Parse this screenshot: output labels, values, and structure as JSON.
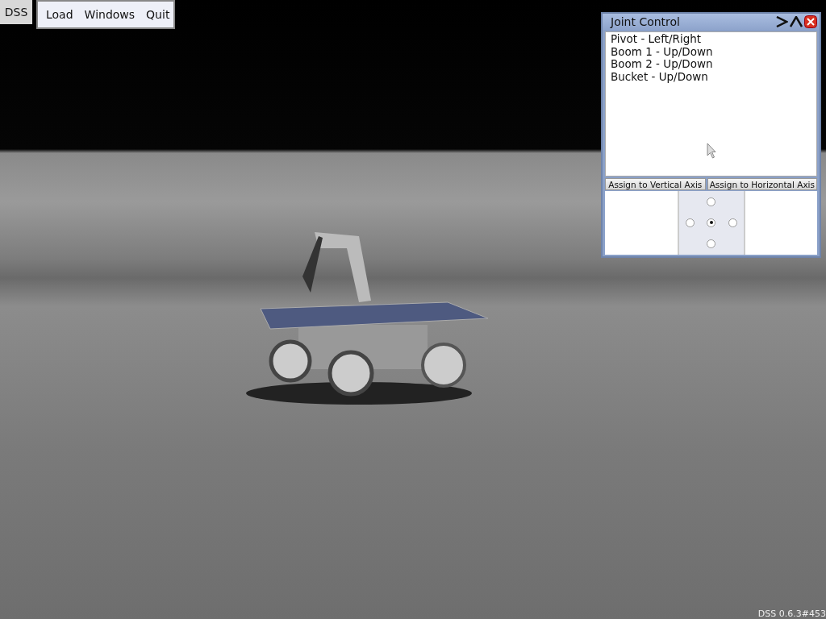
{
  "app_button": {
    "label": "DSS"
  },
  "menu": {
    "items": [
      {
        "label": "Load"
      },
      {
        "label": "Windows"
      },
      {
        "label": "Quit"
      }
    ]
  },
  "joint_control": {
    "title": "Joint Control",
    "joints": [
      {
        "label": "Pivot - Left/Right",
        "selected": false
      },
      {
        "label": "Boom 1 - Up/Down",
        "selected": false
      },
      {
        "label": "Boom 2 - Up/Down",
        "selected": false
      },
      {
        "label": "Bucket - Up/Down",
        "selected": false
      }
    ],
    "assign_buttons": [
      {
        "label": "Assign to Vertical Axis"
      },
      {
        "label": "Assign to Horizontal Axis"
      }
    ],
    "axis_radios": [
      {
        "kind": "up",
        "selected": false
      },
      {
        "kind": "left",
        "selected": false
      },
      {
        "kind": "center",
        "selected": true
      },
      {
        "kind": "right",
        "selected": false
      },
      {
        "kind": "down",
        "selected": false
      }
    ]
  },
  "version": "DSS 0.6.3#453"
}
